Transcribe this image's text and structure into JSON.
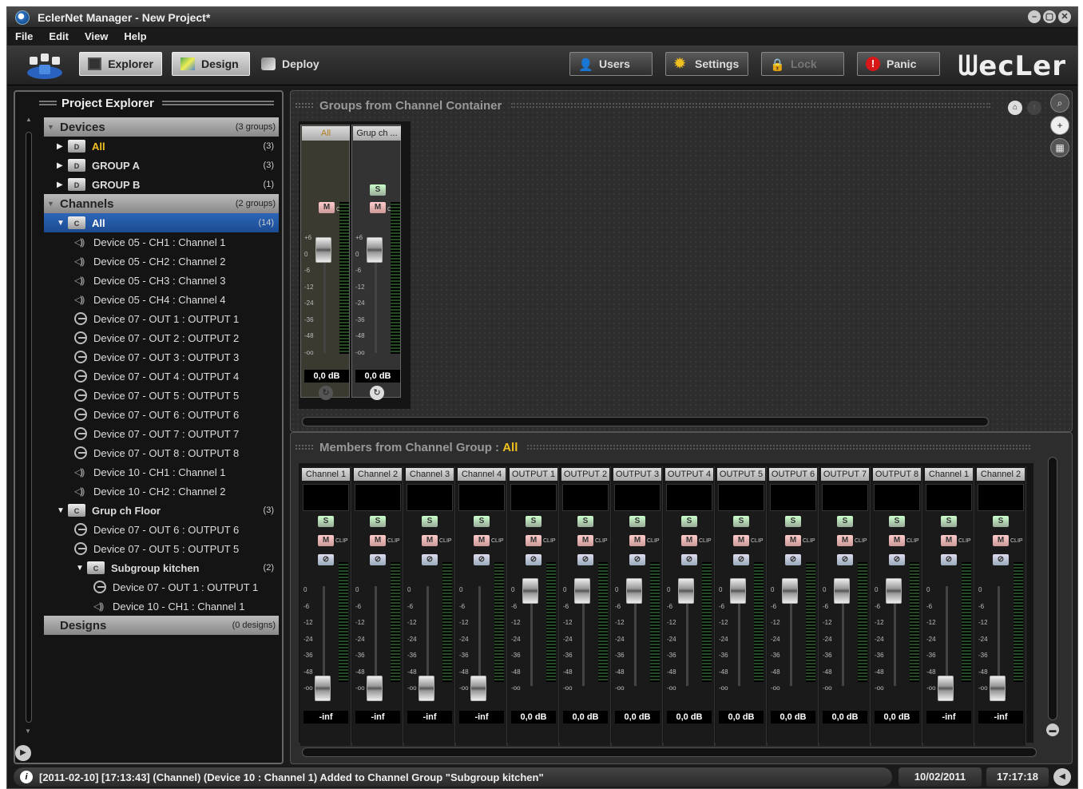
{
  "window": {
    "title": "EclerNet Manager - New Project*"
  },
  "menu": [
    "File",
    "Edit",
    "View",
    "Help"
  ],
  "toolbar": {
    "explorer": "Explorer",
    "design": "Design",
    "deploy": "Deploy",
    "users": "Users",
    "settings": "Settings",
    "lock": "Lock",
    "panic": "Panic",
    "logo": "ᗯecLer"
  },
  "explorer": {
    "title": "Project Explorer",
    "devices": {
      "label": "Devices",
      "count": "(3 groups)",
      "items": [
        {
          "label": "All",
          "count": "(3)"
        },
        {
          "label": "GROUP A",
          "count": "(3)"
        },
        {
          "label": "GROUP B",
          "count": "(1)"
        }
      ]
    },
    "channels": {
      "label": "Channels",
      "count": "(2 groups)",
      "all": {
        "label": "All",
        "count": "(14)"
      },
      "items": [
        "Device 05 - CH1 : Channel 1",
        "Device 05 - CH2 : Channel 2",
        "Device 05 - CH3 : Channel 3",
        "Device 05 - CH4 : Channel 4",
        "Device 07 - OUT 1 : OUTPUT 1",
        "Device 07 - OUT 2 : OUTPUT 2",
        "Device 07 - OUT 3 : OUTPUT 3",
        "Device 07 - OUT 4 : OUTPUT 4",
        "Device 07 - OUT 5 : OUTPUT 5",
        "Device 07 - OUT 6 : OUTPUT 6",
        "Device 07 - OUT 7 : OUTPUT 7",
        "Device 07 - OUT 8 : OUTPUT 8",
        "Device 10 - CH1 : Channel 1",
        "Device 10 - CH2 : Channel 2"
      ],
      "floor": {
        "label": "Grup ch Floor",
        "count": "(3)",
        "items": [
          "Device 07 - OUT 6 : OUTPUT 6",
          "Device 07 - OUT 5 : OUTPUT 5"
        ],
        "kitchen": {
          "label": "Subgroup kitchen",
          "count": "(2)",
          "items": [
            "Device 07 - OUT 1 : OUTPUT 1",
            "Device 10 - CH1 : Channel 1"
          ]
        }
      }
    },
    "designs": {
      "label": "Designs",
      "count": "(0 designs)"
    }
  },
  "groups": {
    "title": "Groups from Channel Container",
    "strips": [
      {
        "label": "All",
        "db": "0,0 dB"
      },
      {
        "label": "Grup ch ...",
        "db": "0,0 dB"
      }
    ]
  },
  "members": {
    "title": "Members from Channel Group :",
    "group": "All",
    "strips": [
      {
        "label": "Channel 1",
        "db": "-inf",
        "level": 0
      },
      {
        "label": "Channel 2",
        "db": "-inf",
        "level": 0
      },
      {
        "label": "Channel 3",
        "db": "-inf",
        "level": 0
      },
      {
        "label": "Channel 4",
        "db": "-inf",
        "level": 0
      },
      {
        "label": "OUTPUT 1",
        "db": "0,0 dB",
        "level": 1
      },
      {
        "label": "OUTPUT 2",
        "db": "0,0 dB",
        "level": 1
      },
      {
        "label": "OUTPUT 3",
        "db": "0,0 dB",
        "level": 1
      },
      {
        "label": "OUTPUT 4",
        "db": "0,0 dB",
        "level": 1
      },
      {
        "label": "OUTPUT 5",
        "db": "0,0 dB",
        "level": 1
      },
      {
        "label": "OUTPUT 6",
        "db": "0,0 dB",
        "level": 1
      },
      {
        "label": "OUTPUT 7",
        "db": "0,0 dB",
        "level": 1
      },
      {
        "label": "OUTPUT 8",
        "db": "0,0 dB",
        "level": 1
      },
      {
        "label": "Channel 1",
        "db": "-inf",
        "level": 0
      },
      {
        "label": "Channel 2",
        "db": "-inf",
        "level": 0
      }
    ],
    "scale": [
      "0",
      "-6",
      "-12",
      "-24",
      "-36",
      "-48",
      "-oo"
    ]
  },
  "group_scale": [
    "+6",
    "0",
    "-6",
    "-12",
    "-24",
    "-36",
    "-48",
    "-oo"
  ],
  "strip_buttons": {
    "solo": "S",
    "mute": "M",
    "clip": "CLIP"
  },
  "status": {
    "message": "[2011-02-10] [17:13:43] (Channel) (Device 10 : Channel 1) Added to Channel Group \"Subgroup kitchen\"",
    "date": "10/02/2011",
    "time": "17:17:18"
  }
}
